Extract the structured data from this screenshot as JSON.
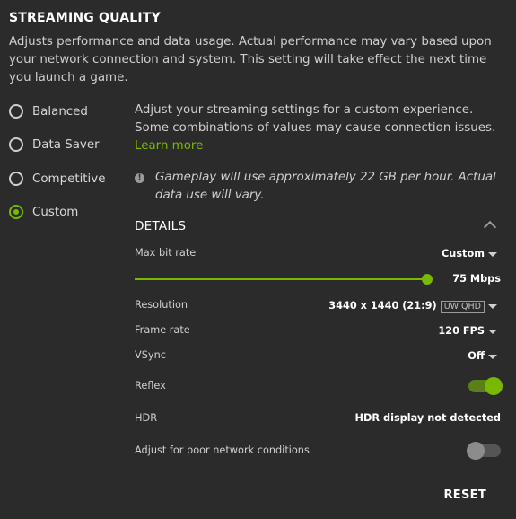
{
  "header": {
    "title": "STREAMING QUALITY",
    "description": "Adjusts performance and data usage. Actual performance may vary based upon your network connection and system. This setting will take effect the next time you launch a game."
  },
  "presets": [
    {
      "label": "Balanced",
      "selected": false
    },
    {
      "label": "Data Saver",
      "selected": false
    },
    {
      "label": "Competitive",
      "selected": false
    },
    {
      "label": "Custom",
      "selected": true
    }
  ],
  "custom": {
    "description": "Adjust your streaming settings for a custom experience. Some combinations of values may cause connection issues.",
    "learn_more": "Learn more",
    "info": "Gameplay will use approximately 22 GB per hour. Actual data use will vary."
  },
  "details": {
    "title": "DETAILS",
    "max_bit_rate": {
      "label": "Max bit rate",
      "value": "Custom",
      "slider_value": "75 Mbps"
    },
    "resolution": {
      "label": "Resolution",
      "value": "3440 x 1440 (21:9)",
      "badge": "UW QHD"
    },
    "frame_rate": {
      "label": "Frame rate",
      "value": "120 FPS"
    },
    "vsync": {
      "label": "VSync",
      "value": "Off"
    },
    "reflex": {
      "label": "Reflex",
      "enabled": true
    },
    "hdr": {
      "label": "HDR",
      "value": "HDR display not detected"
    },
    "poor_network": {
      "label": "Adjust for poor network conditions",
      "enabled": false
    }
  },
  "footer": {
    "reset": "RESET"
  },
  "colors": {
    "accent": "#76b900",
    "background": "#2b2b2b"
  }
}
